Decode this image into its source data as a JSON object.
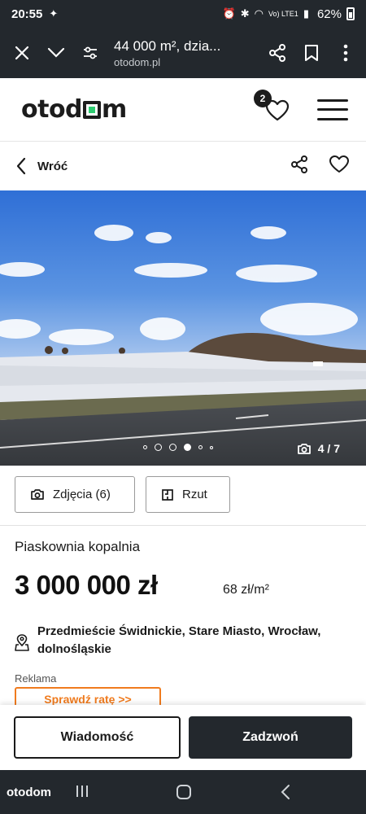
{
  "status_bar": {
    "time": "20:55",
    "network": "Vo) LTE1",
    "battery": "62%"
  },
  "browser": {
    "page_title": "44 000 m², dzia...",
    "domain": "otodom.pl"
  },
  "site_header": {
    "logo_text": "otodom",
    "favorites_count": "2"
  },
  "back_bar": {
    "back_label": "Wróć"
  },
  "gallery": {
    "counter": "4 / 7",
    "current_index": 4,
    "total": 7
  },
  "media_buttons": {
    "photos_label": "Zdjęcia (6)",
    "plan_label": "Rzut"
  },
  "listing": {
    "title": "Piaskownia kopalnia",
    "price": "3 000 000 zł",
    "price_per_m2": "68 zł/m²",
    "location": "Przedmieście Świdnickie, Stare Miasto, Wrocław, dolnośląskie"
  },
  "ad": {
    "label": "Reklama",
    "cta": "Sprawdź ratę >>"
  },
  "actions": {
    "message_label": "Wiadomość",
    "call_label": "Zadzwoń"
  },
  "nav_bar": {
    "mini_logo": "otodom"
  },
  "colors": {
    "brand_green": "#2ecc71",
    "dark": "#23282d",
    "ad_orange": "#f07b1e"
  }
}
